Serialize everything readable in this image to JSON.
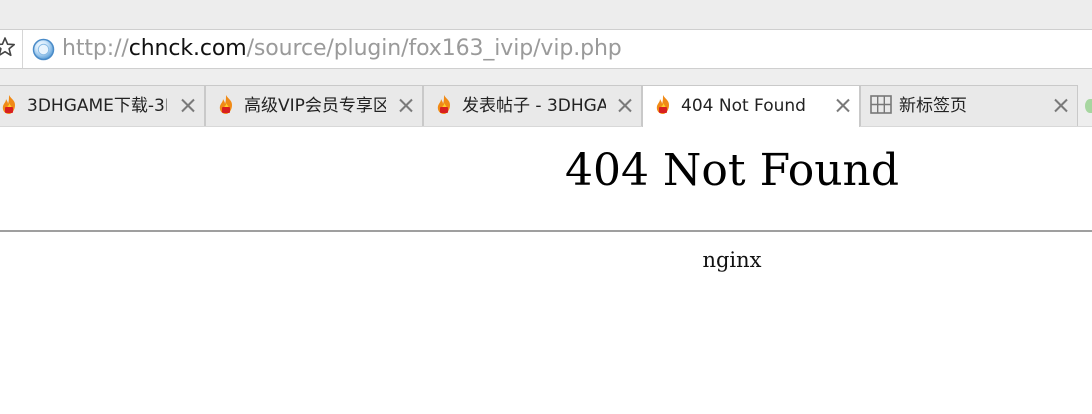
{
  "browser": {
    "address_bar": {
      "scheme": "http://",
      "host": "chnck.com",
      "path": "/source/plugin/fox163_ivip/vip.php"
    },
    "tabs": [
      {
        "title": "3DHGAME下载-3D",
        "favicon": "flame-icon",
        "active": false
      },
      {
        "title": "高级VIP会员专享区",
        "favicon": "flame-icon",
        "active": false
      },
      {
        "title": "发表帖子 - 3DHGA",
        "favicon": "flame-icon",
        "active": false
      },
      {
        "title": "404 Not Found",
        "favicon": "flame-icon",
        "active": true
      },
      {
        "title": "新标签页",
        "favicon": "grid-icon",
        "active": false
      }
    ]
  },
  "page": {
    "heading": "404 Not Found",
    "server": "nginx"
  },
  "colors": {
    "tab_bar": "#eeeeee",
    "active_tab": "#ffffff",
    "url_dim": "#9a9a9a",
    "url_host": "#111111",
    "rule": "#9f9f9f"
  }
}
